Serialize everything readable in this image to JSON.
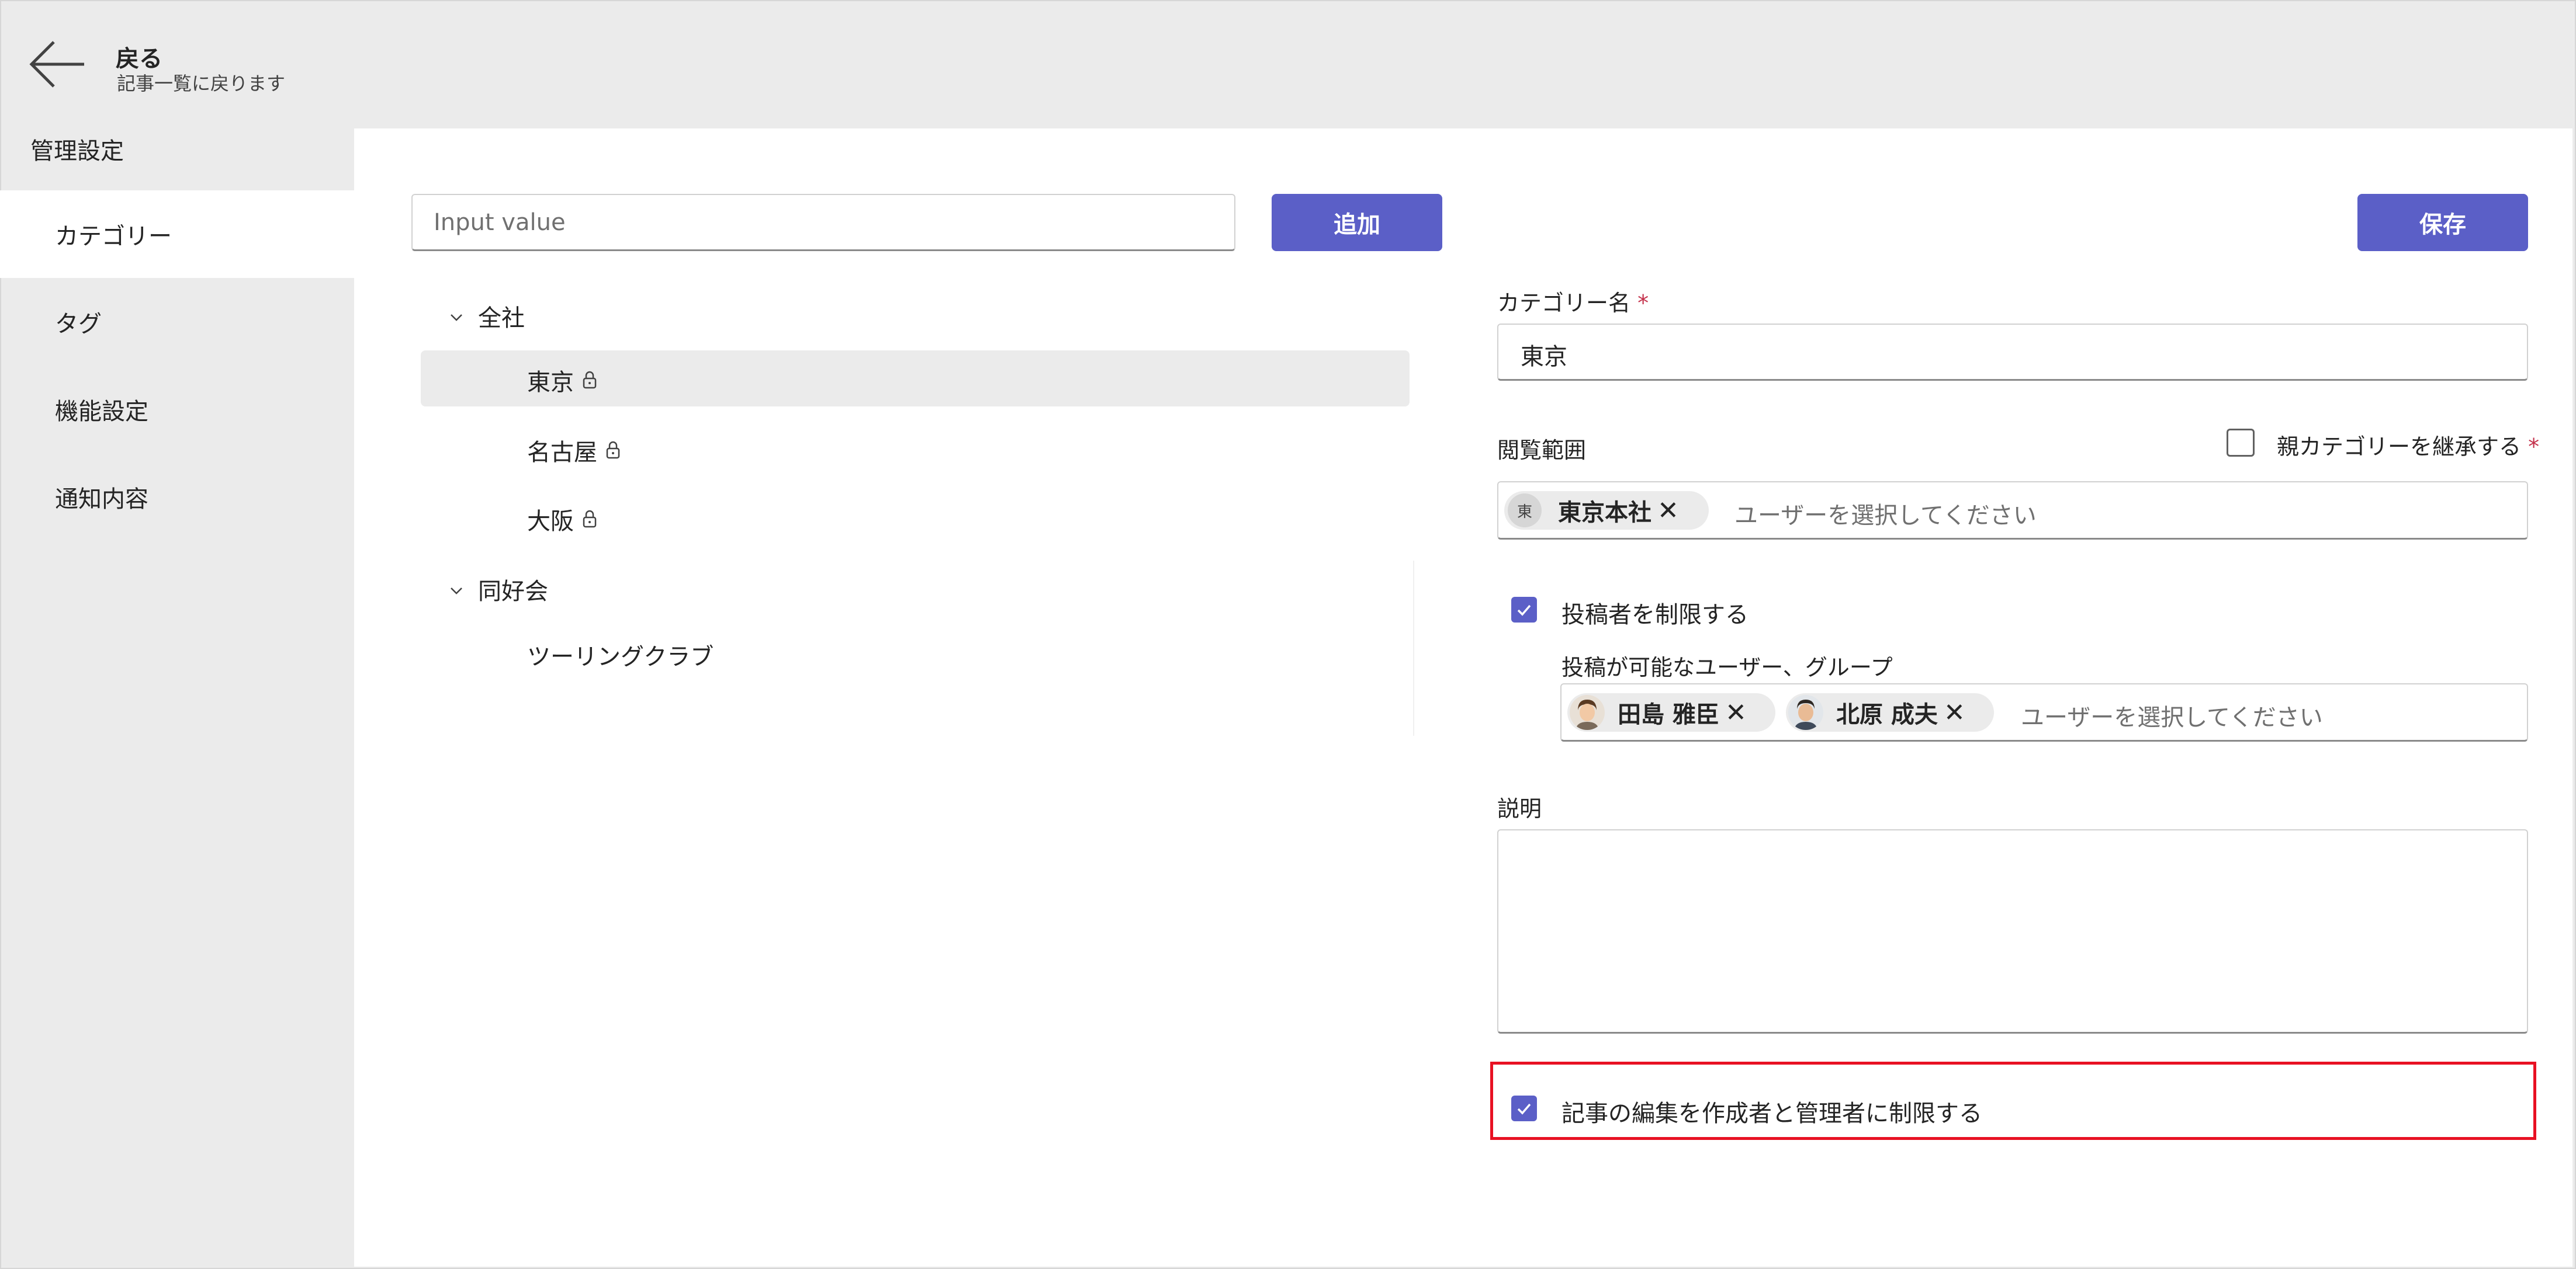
{
  "header": {
    "back_title": "戻る",
    "back_subtitle": "記事一覧に戻ります"
  },
  "sidebar": {
    "heading": "管理設定",
    "items": [
      {
        "label": "カテゴリー",
        "active": true
      },
      {
        "label": "タグ",
        "active": false
      },
      {
        "label": "機能設定",
        "active": false
      },
      {
        "label": "通知内容",
        "active": false
      }
    ]
  },
  "toolbar": {
    "search_placeholder": "Input value",
    "add_label": "追加",
    "save_label": "保存"
  },
  "tree": {
    "groups": [
      {
        "label": "全社",
        "children": [
          {
            "label": "東京",
            "locked": true,
            "selected": true
          },
          {
            "label": "名古屋",
            "locked": true,
            "selected": false
          },
          {
            "label": "大阪",
            "locked": true,
            "selected": false
          }
        ]
      },
      {
        "label": "同好会",
        "children": [
          {
            "label": "ツーリングクラブ",
            "locked": false,
            "selected": false
          }
        ]
      }
    ]
  },
  "form": {
    "category_name_label": "カテゴリー名",
    "required_mark": "*",
    "category_name_value": "東京",
    "view_scope_label": "閲覧範囲",
    "inherit_label": "親カテゴリーを継承する",
    "inherit_checked": false,
    "view_scope_chip": {
      "initial": "東",
      "name": "東京本社"
    },
    "user_placeholder": "ユーザーを選択してください",
    "restrict_posters_label": "投稿者を制限する",
    "restrict_posters_checked": true,
    "allowed_posters_label": "投稿が可能なユーザー、グループ",
    "poster_chips": [
      {
        "name": "田島 雅臣"
      },
      {
        "name": "北原 成夫"
      }
    ],
    "description_label": "説明",
    "description_value": "",
    "restrict_edit_label": "記事の編集を作成者と管理者に制限する",
    "restrict_edit_checked": true
  },
  "colors": {
    "accent": "#5b5fc7",
    "highlight": "#e81123",
    "required": "#c4314b"
  },
  "icons": {
    "close": "✕",
    "check": "✓",
    "chevron": "⌄"
  }
}
